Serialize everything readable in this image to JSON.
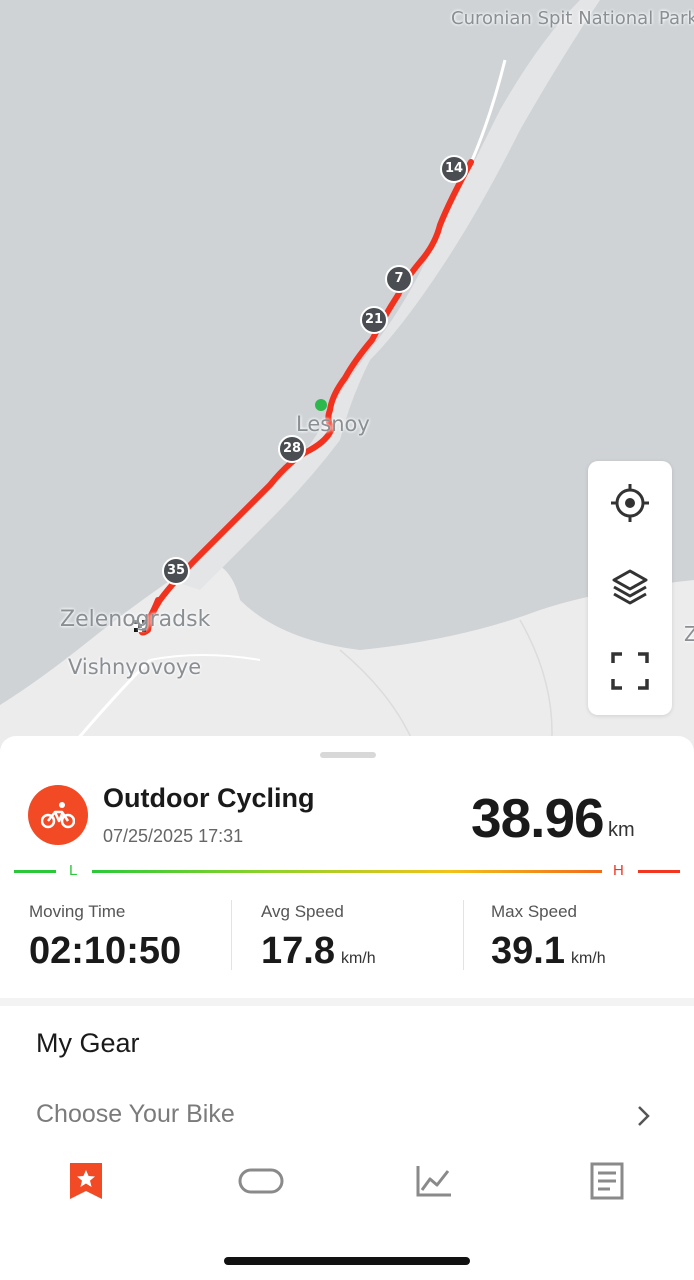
{
  "map": {
    "labels": {
      "park": "Curonian Spit National Park",
      "lesnoy": "Lesnoy",
      "zelenogradsk": "Zelenogradsk",
      "vishnyovoye": "Vishnyovoye",
      "edge": "Z"
    },
    "km_markers": [
      "14",
      "7",
      "21",
      "28",
      "35"
    ],
    "controls": [
      "locate-icon",
      "layers-icon",
      "fullscreen-icon"
    ],
    "colors": {
      "route": "#f0321e",
      "start": "#2db84d",
      "water": "#cfd3d6",
      "land": "#ececec"
    }
  },
  "activity": {
    "icon": "cycling-icon",
    "title": "Outdoor Cycling",
    "date": "07/25/2025 17:31",
    "distance": "38.96",
    "distance_unit": "km",
    "scale_low": "L",
    "scale_high": "H",
    "stats": [
      {
        "label": "Moving Time",
        "value": "02:10:50",
        "unit": ""
      },
      {
        "label": "Avg Speed",
        "value": "17.8",
        "unit": "km/h"
      },
      {
        "label": "Max Speed",
        "value": "39.1",
        "unit": "km/h"
      }
    ]
  },
  "gear": {
    "title": "My Gear",
    "choose_bike": "Choose Your Bike"
  },
  "tabs": [
    "bookmark-icon",
    "capsule-icon",
    "chart-icon",
    "document-icon"
  ],
  "accent": "#f24a25"
}
